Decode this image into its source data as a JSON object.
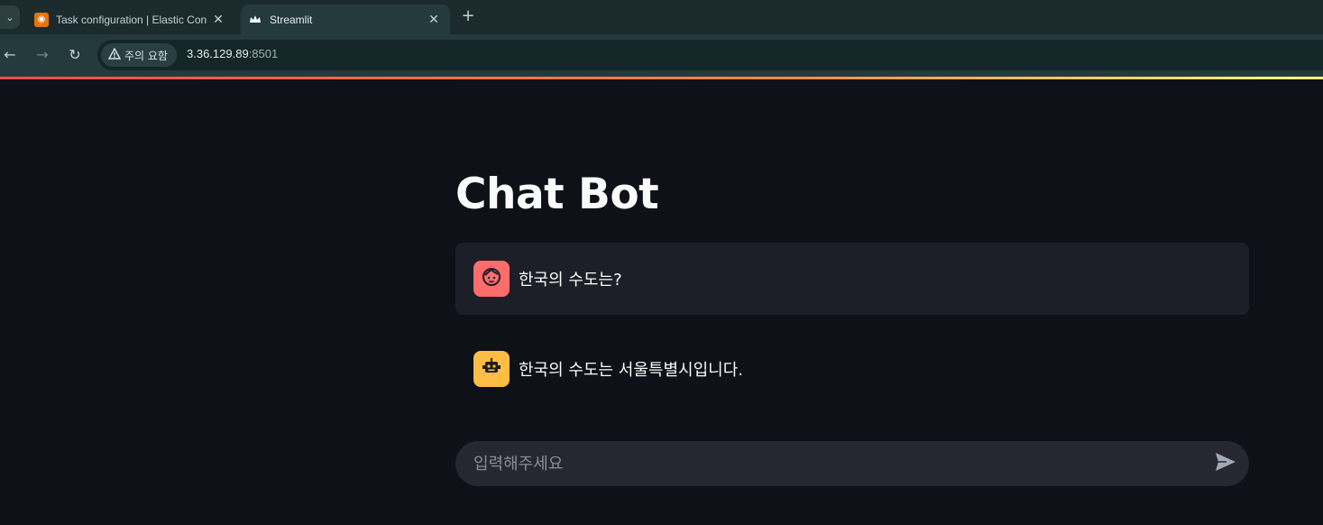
{
  "browser": {
    "tabs": [
      {
        "title": "Task configuration | Elastic Con",
        "active": false,
        "icon": "elastic-favicon"
      },
      {
        "title": "Streamlit",
        "active": true,
        "icon": "streamlit-crown-favicon"
      }
    ],
    "security_label": "주의 요함",
    "url_host": "3.36.129.89",
    "url_port": ":8501"
  },
  "app": {
    "title": "Chat Bot",
    "messages": [
      {
        "role": "user",
        "text": "한국의 수도는?",
        "avatar_color": "#ff6c6c",
        "avatar_icon": "face-icon"
      },
      {
        "role": "assistant",
        "text": "한국의 수도는 서울특별시입니다.",
        "avatar_color": "#ffbd45",
        "avatar_icon": "robot-icon"
      }
    ],
    "chat_input": {
      "placeholder": "입력해주세요",
      "value": ""
    }
  },
  "colors": {
    "background": "#0e1117",
    "user_message_bg": "#1c1f27",
    "input_bg": "#262730",
    "accent_red": "#ff4b4b"
  }
}
